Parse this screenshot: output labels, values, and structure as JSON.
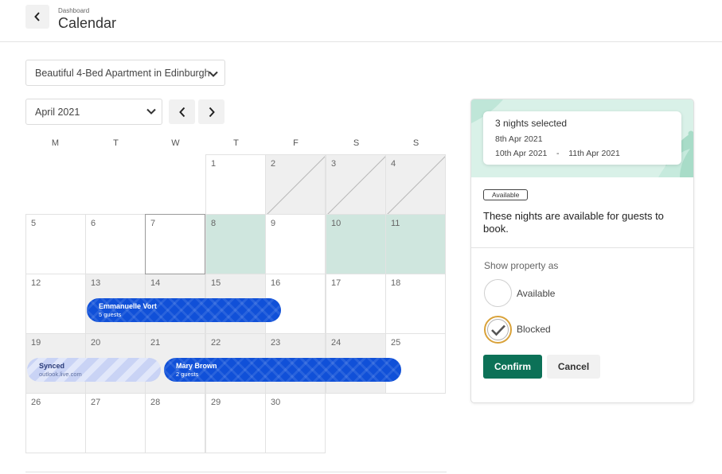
{
  "header": {
    "breadcrumb": "Dashboard",
    "title": "Calendar",
    "back_icon": "chevron-left-icon"
  },
  "property_select": {
    "value": "Beautiful 4-Bed Apartment in Edinburgh"
  },
  "month_select": {
    "value": "April 2021"
  },
  "weekdays": [
    "M",
    "T",
    "W",
    "T",
    "F",
    "S",
    "S"
  ],
  "calendar": {
    "days": [
      {
        "n": "1",
        "col": 3,
        "row": 0,
        "state": "normal"
      },
      {
        "n": "2",
        "col": 4,
        "row": 0,
        "state": "past"
      },
      {
        "n": "3",
        "col": 5,
        "row": 0,
        "state": "past"
      },
      {
        "n": "4",
        "col": 6,
        "row": 0,
        "state": "past"
      },
      {
        "n": "5",
        "col": 0,
        "row": 1,
        "state": "normal"
      },
      {
        "n": "6",
        "col": 1,
        "row": 1,
        "state": "normal"
      },
      {
        "n": "7",
        "col": 2,
        "row": 1,
        "state": "today"
      },
      {
        "n": "8",
        "col": 3,
        "row": 1,
        "state": "selected"
      },
      {
        "n": "9",
        "col": 4,
        "row": 1,
        "state": "normal"
      },
      {
        "n": "10",
        "col": 5,
        "row": 1,
        "state": "selected"
      },
      {
        "n": "11",
        "col": 6,
        "row": 1,
        "state": "selected"
      },
      {
        "n": "12",
        "col": 0,
        "row": 2,
        "state": "normal"
      },
      {
        "n": "13",
        "col": 1,
        "row": 2,
        "state": "booked"
      },
      {
        "n": "14",
        "col": 2,
        "row": 2,
        "state": "booked"
      },
      {
        "n": "15",
        "col": 3,
        "row": 2,
        "state": "booked"
      },
      {
        "n": "16",
        "col": 4,
        "row": 2,
        "state": "normal"
      },
      {
        "n": "17",
        "col": 5,
        "row": 2,
        "state": "normal"
      },
      {
        "n": "18",
        "col": 6,
        "row": 2,
        "state": "normal"
      },
      {
        "n": "19",
        "col": 0,
        "row": 3,
        "state": "booked"
      },
      {
        "n": "20",
        "col": 1,
        "row": 3,
        "state": "booked"
      },
      {
        "n": "21",
        "col": 2,
        "row": 3,
        "state": "booked"
      },
      {
        "n": "22",
        "col": 3,
        "row": 3,
        "state": "booked"
      },
      {
        "n": "23",
        "col": 4,
        "row": 3,
        "state": "booked"
      },
      {
        "n": "24",
        "col": 5,
        "row": 3,
        "state": "booked"
      },
      {
        "n": "25",
        "col": 6,
        "row": 3,
        "state": "normal"
      },
      {
        "n": "26",
        "col": 0,
        "row": 4,
        "state": "normal"
      },
      {
        "n": "27",
        "col": 1,
        "row": 4,
        "state": "normal"
      },
      {
        "n": "28",
        "col": 2,
        "row": 4,
        "state": "normal"
      },
      {
        "n": "29",
        "col": 3,
        "row": 4,
        "state": "normal"
      },
      {
        "n": "30",
        "col": 4,
        "row": 4,
        "state": "normal"
      }
    ],
    "bookings": [
      {
        "name": "Emmanuelle Vort",
        "sub": "5 guests",
        "kind": "guest"
      },
      {
        "name": "Synced",
        "sub": "outlook.live.com",
        "kind": "synced"
      },
      {
        "name": "Mary Brown",
        "sub": "2 guests",
        "kind": "guest"
      }
    ]
  },
  "panel": {
    "summary_title": "3 nights selected",
    "summary_date": "8th Apr 2021",
    "summary_range": "10th Apr 2021    -    11th Apr 2021",
    "badge": "Available",
    "description": "These nights are available for guests to book.",
    "show_label": "Show property as",
    "options": [
      {
        "label": "Available",
        "checked": false
      },
      {
        "label": "Blocked",
        "checked": true
      }
    ],
    "confirm_label": "Confirm",
    "cancel_label": "Cancel"
  },
  "colors": {
    "selected_day": "#cfe6de",
    "booking": "#1050d8",
    "synced": "#c9d3f5",
    "confirm": "#0c7157",
    "blocked_ring": "#d9a23a"
  }
}
